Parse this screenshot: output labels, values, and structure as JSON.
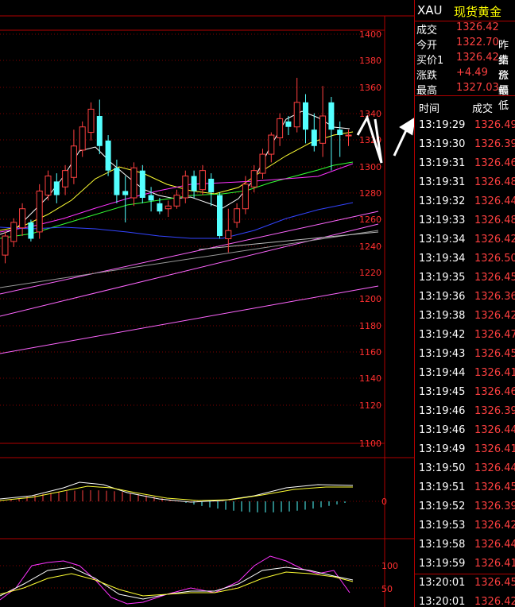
{
  "header": {
    "symbol": "XAU",
    "name": "现货黄金"
  },
  "quote": [
    {
      "label": "成交",
      "value": "1326.42",
      "label2": ""
    },
    {
      "label": "今开",
      "value": "1322.70",
      "label2": "昨结"
    },
    {
      "label": "买价1",
      "value": "1326.42",
      "label2": "卖价"
    },
    {
      "label": "涨跌",
      "value": "+4.49",
      "label2": "涨幅"
    },
    {
      "label": "最高",
      "value": "1327.03",
      "label2": "最低"
    }
  ],
  "ticks_header": {
    "time": "时间",
    "price": "成交"
  },
  "ticks": [
    {
      "time": "13:19:29",
      "price": "1326.49"
    },
    {
      "time": "13:19:30",
      "price": "1326.39"
    },
    {
      "time": "13:19:31",
      "price": "1326.46"
    },
    {
      "time": "13:19:31",
      "price": "1326.48"
    },
    {
      "time": "13:19:32",
      "price": "1326.44"
    },
    {
      "time": "13:19:33",
      "price": "1326.48"
    },
    {
      "time": "13:19:34",
      "price": "1326.42"
    },
    {
      "time": "13:19:34",
      "price": "1326.50"
    },
    {
      "time": "13:19:35",
      "price": "1326.45"
    },
    {
      "time": "13:19:36",
      "price": "1326.36"
    },
    {
      "time": "13:19:38",
      "price": "1326.42"
    },
    {
      "time": "13:19:42",
      "price": "1326.47"
    },
    {
      "time": "13:19:43",
      "price": "1326.45"
    },
    {
      "time": "13:19:44",
      "price": "1326.41"
    },
    {
      "time": "13:19:45",
      "price": "1326.46"
    },
    {
      "time": "13:19:46",
      "price": "1326.39"
    },
    {
      "time": "13:19:46",
      "price": "1326.44"
    },
    {
      "time": "13:19:49",
      "price": "1326.41"
    },
    {
      "time": "13:19:50",
      "price": "1326.44"
    },
    {
      "time": "13:19:51",
      "price": "1326.45"
    },
    {
      "time": "13:19:52",
      "price": "1326.39"
    },
    {
      "time": "13:19:53",
      "price": "1326.42"
    },
    {
      "time": "13:19:58",
      "price": "1326.44"
    },
    {
      "time": "13:19:59",
      "price": "1326.41"
    },
    {
      "time": "13:20:01",
      "price": "1326.45"
    },
    {
      "time": "13:20:01",
      "price": "1326.42"
    }
  ],
  "chart_data": {
    "type": "candlestick",
    "ylabels": [
      "1400",
      "1380",
      "1360",
      "1340",
      "1320",
      "1300",
      "1280",
      "1260",
      "1240",
      "1220",
      "1200",
      "1180",
      "1160",
      "1140",
      "1120",
      "1100"
    ],
    "macd_label": "0",
    "kdj_labels": [
      "100",
      "50"
    ],
    "ylim": [
      1100,
      1400
    ],
    "candles": [
      [
        1238,
        1252,
        1232,
        1255
      ],
      [
        1248,
        1262,
        1244,
        1265
      ],
      [
        1258,
        1272,
        1252,
        1276
      ],
      [
        1262,
        1250,
        1248,
        1264
      ],
      [
        1255,
        1285,
        1250,
        1290
      ],
      [
        1282,
        1296,
        1278,
        1300
      ],
      [
        1292,
        1282,
        1276,
        1298
      ],
      [
        1288,
        1300,
        1282,
        1304
      ],
      [
        1295,
        1318,
        1290,
        1330
      ],
      [
        1315,
        1332,
        1310,
        1336
      ],
      [
        1328,
        1345,
        1322,
        1350
      ],
      [
        1340,
        1318,
        1312,
        1352
      ],
      [
        1322,
        1300,
        1296,
        1326
      ],
      [
        1302,
        1282,
        1276,
        1308
      ],
      [
        1285,
        1282,
        1262,
        1296
      ],
      [
        1280,
        1302,
        1274,
        1306
      ],
      [
        1300,
        1280,
        1276,
        1304
      ],
      [
        1282,
        1278,
        1270,
        1288
      ],
      [
        1276,
        1270,
        1268,
        1280
      ],
      [
        1272,
        1274,
        1266,
        1278
      ],
      [
        1274,
        1282,
        1272,
        1286
      ],
      [
        1280,
        1296,
        1276,
        1300
      ],
      [
        1296,
        1285,
        1280,
        1300
      ],
      [
        1286,
        1300,
        1282,
        1304
      ],
      [
        1294,
        1284,
        1274,
        1298
      ],
      [
        1282,
        1252,
        1250,
        1284
      ],
      [
        1250,
        1256,
        1240,
        1272
      ],
      [
        1262,
        1272,
        1258,
        1276
      ],
      [
        1272,
        1290,
        1268,
        1296
      ],
      [
        1288,
        1300,
        1284,
        1304
      ],
      [
        1298,
        1312,
        1294,
        1316
      ],
      [
        1312,
        1326,
        1306,
        1328
      ],
      [
        1324,
        1338,
        1318,
        1342
      ],
      [
        1336,
        1332,
        1326,
        1340
      ],
      [
        1332,
        1350,
        1328,
        1368
      ],
      [
        1350,
        1330,
        1320,
        1356
      ],
      [
        1330,
        1318,
        1314,
        1342
      ],
      [
        1320,
        1340,
        1310,
        1362
      ],
      [
        1350,
        1330,
        1300,
        1354
      ],
      [
        1330,
        1326,
        1310,
        1336
      ],
      [
        1326,
        1326,
        1318,
        1330
      ]
    ]
  },
  "colors": {
    "up": "#ff4040",
    "down": "#54ffff",
    "frame": "#b00000",
    "text": "#ff3030"
  }
}
